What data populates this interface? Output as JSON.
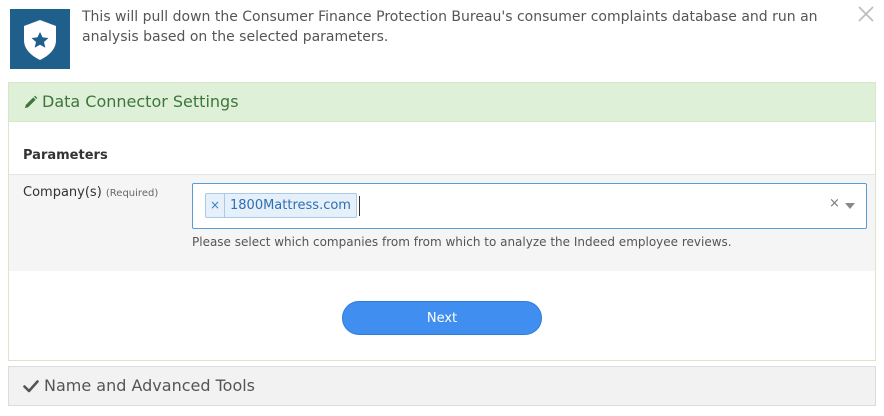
{
  "header": {
    "description": "This will pull down the Consumer Finance Protection Bureau's consumer complaints database and run an analysis based on the selected parameters.",
    "logo_icon": "shield-star-icon",
    "logo_color": "#1f5f8b",
    "close_icon": "close-icon"
  },
  "connector_panel": {
    "title": "Data Connector Settings",
    "icon": "pencil-icon",
    "header_color": "#dff0d8",
    "title_color": "#3c763d"
  },
  "parameters": {
    "heading": "Parameters",
    "company_field": {
      "label": "Company(s)",
      "required_label": "(Required)",
      "selected_tags": [
        "1800Mattress.com"
      ],
      "tag_remove_glyph": "×",
      "clear_glyph": "×",
      "help_text": "Please select which companies from from which to analyze the Indeed employee reviews."
    }
  },
  "actions": {
    "next_label": "Next",
    "next_color": "#3f8ef0"
  },
  "advanced_panel": {
    "title": "Name and Advanced Tools",
    "icon": "checkmark-icon"
  }
}
